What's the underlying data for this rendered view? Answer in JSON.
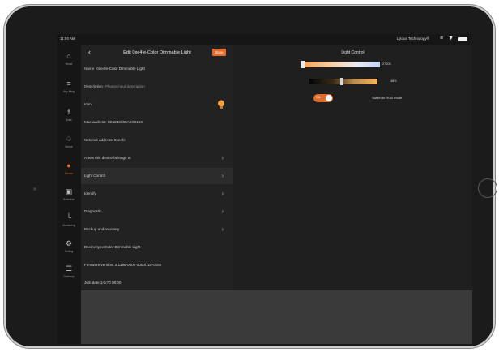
{
  "status": {
    "time": "11:04 AM",
    "network": "Lytous Technology®",
    "icons": {
      "signal": "signal-bars-icon",
      "wifi": "wifi-icon",
      "battery": "battery-icon"
    }
  },
  "sidebar": {
    "items": [
      {
        "label": "Home",
        "icon": "home-icon",
        "glyph": "⌂"
      },
      {
        "label": "Any thing",
        "icon": "menu-icon",
        "glyph": "≡"
      },
      {
        "label": "Area",
        "icon": "area-icon",
        "glyph": "♗"
      },
      {
        "label": "Scene",
        "icon": "scene-icon",
        "glyph": "♤"
      },
      {
        "label": "Device",
        "icon": "bulb-icon",
        "glyph": "●",
        "active": true
      },
      {
        "label": "Schedule",
        "icon": "calendar-icon",
        "glyph": "▣"
      },
      {
        "label": "Monitoring",
        "icon": "chart-icon",
        "glyph": "└"
      },
      {
        "label": "Setting",
        "icon": "settings-icon",
        "glyph": "⚙"
      },
      {
        "label": "Gateway",
        "icon": "gateway-icon",
        "glyph": "☰"
      }
    ]
  },
  "header": {
    "title": "Edit 0xe4fe-Color Dimmable Light",
    "save_label": "Save"
  },
  "fields": {
    "name_label": "Name",
    "name_value": "0xe4fe-Color Dimmable Light",
    "description_label": "Description",
    "description_placeholder": "Please input description",
    "icon_label": "Icon",
    "mac_address": "Mac address: 0D1248000A0C9153",
    "network_address": "Network address: 0xe4fe",
    "areas": "Areas this device belongs to",
    "light_control": "Light Control",
    "identify": "Identify",
    "diagnostic": "Diagnostic",
    "backup": "Backup and recovery",
    "device_type": "Device type:Color Dimmable Light",
    "firmware": "Firmware version: 2.1186-0000-0000/115-0180",
    "join_date": "Join date:1/1/70 08:00"
  },
  "light_control": {
    "title": "Light Control",
    "color_temp": "2700K",
    "brightness": "48%",
    "brightness_value": 0.48,
    "toggle_text": "ON",
    "rgb_label": "Switch to RGB mode",
    "colors": {
      "accent": "#e06c2c",
      "panel": "#222222",
      "background": "#2e2e2e"
    }
  }
}
